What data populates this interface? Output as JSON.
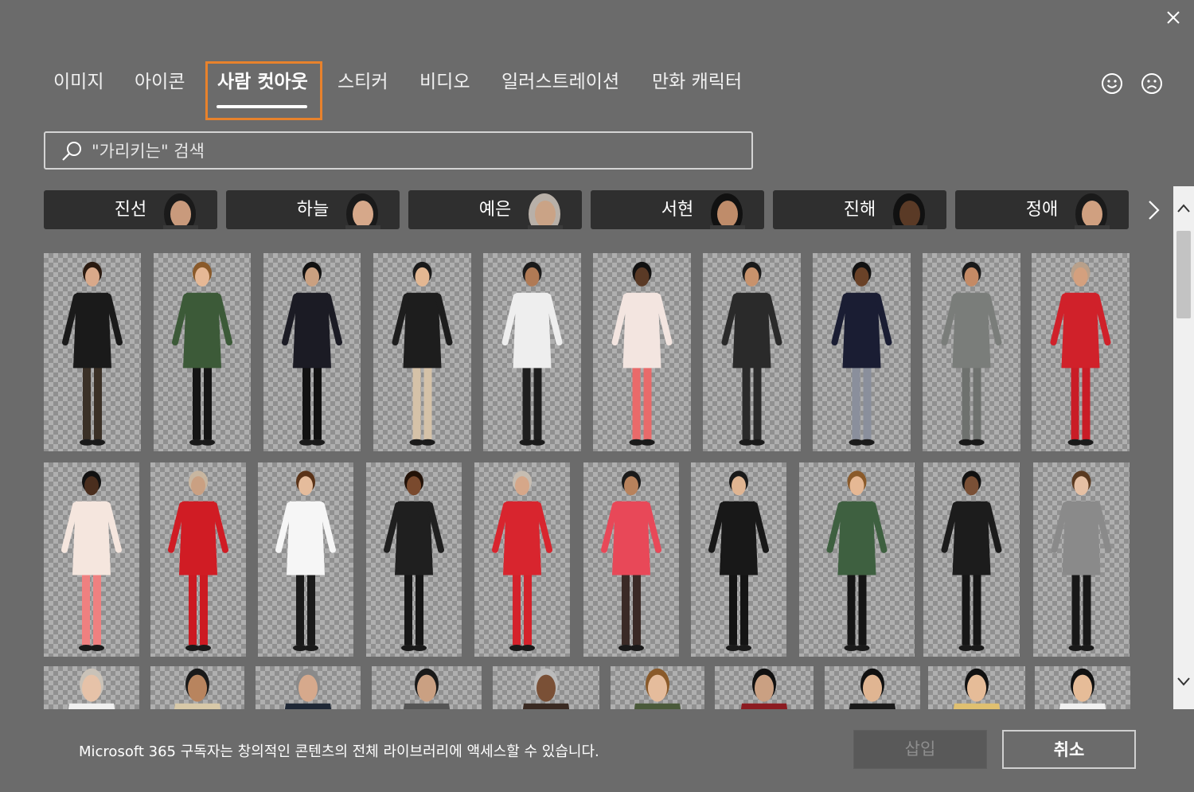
{
  "dialog": {
    "close_icon": "close-icon"
  },
  "tabs": [
    {
      "label": "이미지",
      "active": false
    },
    {
      "label": "아이콘",
      "active": false
    },
    {
      "label": "사람 컷아웃",
      "active": true
    },
    {
      "label": "스티커",
      "active": false
    },
    {
      "label": "비디오",
      "active": false
    },
    {
      "label": "일러스트레이션",
      "active": false
    },
    {
      "label": "만화 캐릭터",
      "active": false
    }
  ],
  "feedback": {
    "smile_icon": "smile-icon",
    "frown_icon": "frown-icon"
  },
  "search": {
    "placeholder": "\"가리키는\" 검색",
    "value": ""
  },
  "people_chips": [
    {
      "label": "진선"
    },
    {
      "label": "하늘"
    },
    {
      "label": "예은"
    },
    {
      "label": "서현"
    },
    {
      "label": "진해"
    },
    {
      "label": "정애"
    }
  ],
  "footer": {
    "message": "Microsoft 365 구독자는 창의적인 콘텐츠의 전체 라이브러리에 액세스할 수 있습니다.",
    "insert_label": "삽입",
    "cancel_label": "취소"
  },
  "colors": {
    "background": "#6b6b6b",
    "focus_outline": "#e8822c",
    "chip": "#2f2f2f"
  },
  "gallery": {
    "rows": [
      [
        {
          "top": "#1a1a1a",
          "bottom": "#3a3026",
          "skin": "#d9a98a",
          "hair": "#2a1a10"
        },
        {
          "top": "#3c5a38",
          "bottom": "#151515",
          "skin": "#e6b895",
          "hair": "#8a5a2a"
        },
        {
          "top": "#1b1b24",
          "bottom": "#111111",
          "skin": "#caa080",
          "hair": "#111111"
        },
        {
          "top": "#1d1d1d",
          "bottom": "#d5c2a8",
          "skin": "#e3b792",
          "hair": "#1a1a1a"
        },
        {
          "top": "#eeeeee",
          "bottom": "#1e1e1e",
          "skin": "#b07a55",
          "hair": "#1a1a1a"
        },
        {
          "top": "#f3e5e0",
          "bottom": "#e96a6a",
          "skin": "#5a3a26",
          "hair": "#111111"
        },
        {
          "top": "#2a2a2a",
          "bottom": "#2a2a2a",
          "skin": "#c8926c",
          "hair": "#1a1a1a"
        },
        {
          "top": "#1a1d33",
          "bottom": "#8a8f9c",
          "skin": "#6a4228",
          "hair": "#111111"
        },
        {
          "top": "#7a7d7a",
          "bottom": "#6e716e",
          "skin": "#c48a65",
          "hair": "#1a1a1a"
        },
        {
          "top": "#d0212a",
          "bottom": "#c91c26",
          "skin": "#d4a07e",
          "hair": "#b8a08a"
        }
      ],
      [
        {
          "top": "#f5e6de",
          "bottom": "#ef8080",
          "skin": "#4a2e1e",
          "hair": "#111111"
        },
        {
          "top": "#d01c24",
          "bottom": "#cc1a22",
          "skin": "#caa082",
          "hair": "#c8b6a0"
        },
        {
          "top": "#f6f6f6",
          "bottom": "#1a1a1a",
          "skin": "#e5bc9c",
          "hair": "#5a3318"
        },
        {
          "top": "#1f1f1f",
          "bottom": "#161616",
          "skin": "#7a4a2e",
          "hair": "#221208"
        },
        {
          "top": "#d8252e",
          "bottom": "#d4222b",
          "skin": "#d6a789",
          "hair": "#c6bdb2"
        },
        {
          "top": "#e84858",
          "bottom": "#3a2a26",
          "skin": "#b8825c",
          "hair": "#1a1a1a"
        },
        {
          "top": "#181818",
          "bottom": "#141414",
          "skin": "#e0b592",
          "hair": "#1a1a1a"
        },
        {
          "top": "#3e6040",
          "bottom": "#151515",
          "skin": "#e6b894",
          "hair": "#8a5a2a"
        },
        {
          "top": "#1c1c1c",
          "bottom": "#161616",
          "skin": "#7a5036",
          "hair": "#111111"
        },
        {
          "top": "#8a8a8a",
          "bottom": "#181818",
          "skin": "#e5c0a4",
          "hair": "#5a3a20"
        }
      ],
      [
        {
          "top": "#f0f0f0",
          "bottom": "#f0f0f0",
          "skin": "#e6c2a8",
          "hair": "#c9c2b8"
        },
        {
          "top": "#d8c9a8",
          "bottom": "#d8c9a8",
          "skin": "#b8845e",
          "hair": "#1a1a1a"
        },
        {
          "top": "#1f2836",
          "bottom": "#1f2836",
          "skin": "#d6a98c",
          "hair": "#8a8a8a"
        },
        {
          "top": "#555555",
          "bottom": "#555555",
          "skin": "#caa082",
          "hair": "#1a1a1a"
        },
        {
          "top": "#3a2a22",
          "bottom": "#3a2a22",
          "skin": "#7a5036",
          "hair": "#bbbbbb"
        },
        {
          "top": "#4a5a3a",
          "bottom": "#4a5a3a",
          "skin": "#e5bc9c",
          "hair": "#8a5a2a"
        },
        {
          "top": "#8c1c22",
          "bottom": "#8c1c22",
          "skin": "#caa082",
          "hair": "#111111"
        },
        {
          "top": "#1a1a1a",
          "bottom": "#1a1a1a",
          "skin": "#e0b592",
          "hair": "#111111"
        },
        {
          "top": "#e0c070",
          "bottom": "#e0c070",
          "skin": "#e6bc98",
          "hair": "#111111"
        },
        {
          "top": "#f0f0f0",
          "bottom": "#f0f0f0",
          "skin": "#e6bc98",
          "hair": "#111111"
        }
      ]
    ]
  }
}
